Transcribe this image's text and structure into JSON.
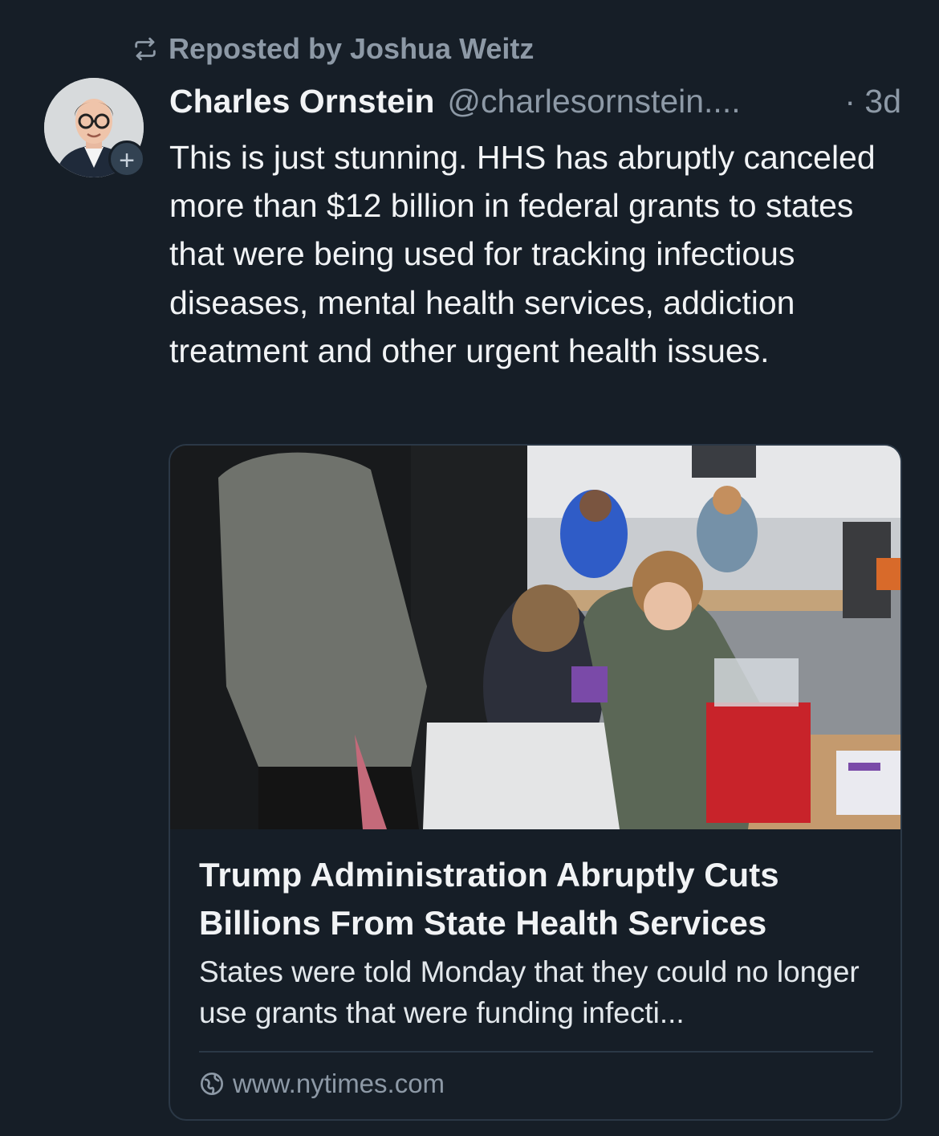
{
  "repost": {
    "icon": "repost-icon",
    "label": "Reposted by Joshua Weitz"
  },
  "author": {
    "name": "Charles Ornstein",
    "handle": "@charlesornstein....",
    "time": "· 3d",
    "avatar_icon": "avatar-photo",
    "follow_badge": "+"
  },
  "post": {
    "text": "This is just stunning. HHS has abruptly canceled more than $12 billion in federal grants to states that were being used for tracking infectious diseases, mental health services, addiction treatment and other urgent health issues."
  },
  "link_card": {
    "title": "Trump Administration Abruptly Cuts Billions From State Health Services",
    "description": "States were told Monday that they could no longer use grants that were funding infecti...",
    "domain": "www.nytimes.com",
    "domain_icon": "globe-icon"
  },
  "colors": {
    "background": "#161e27",
    "text_primary": "#f1f3f5",
    "text_secondary": "#8d99a6",
    "card_border": "#2b3846"
  }
}
